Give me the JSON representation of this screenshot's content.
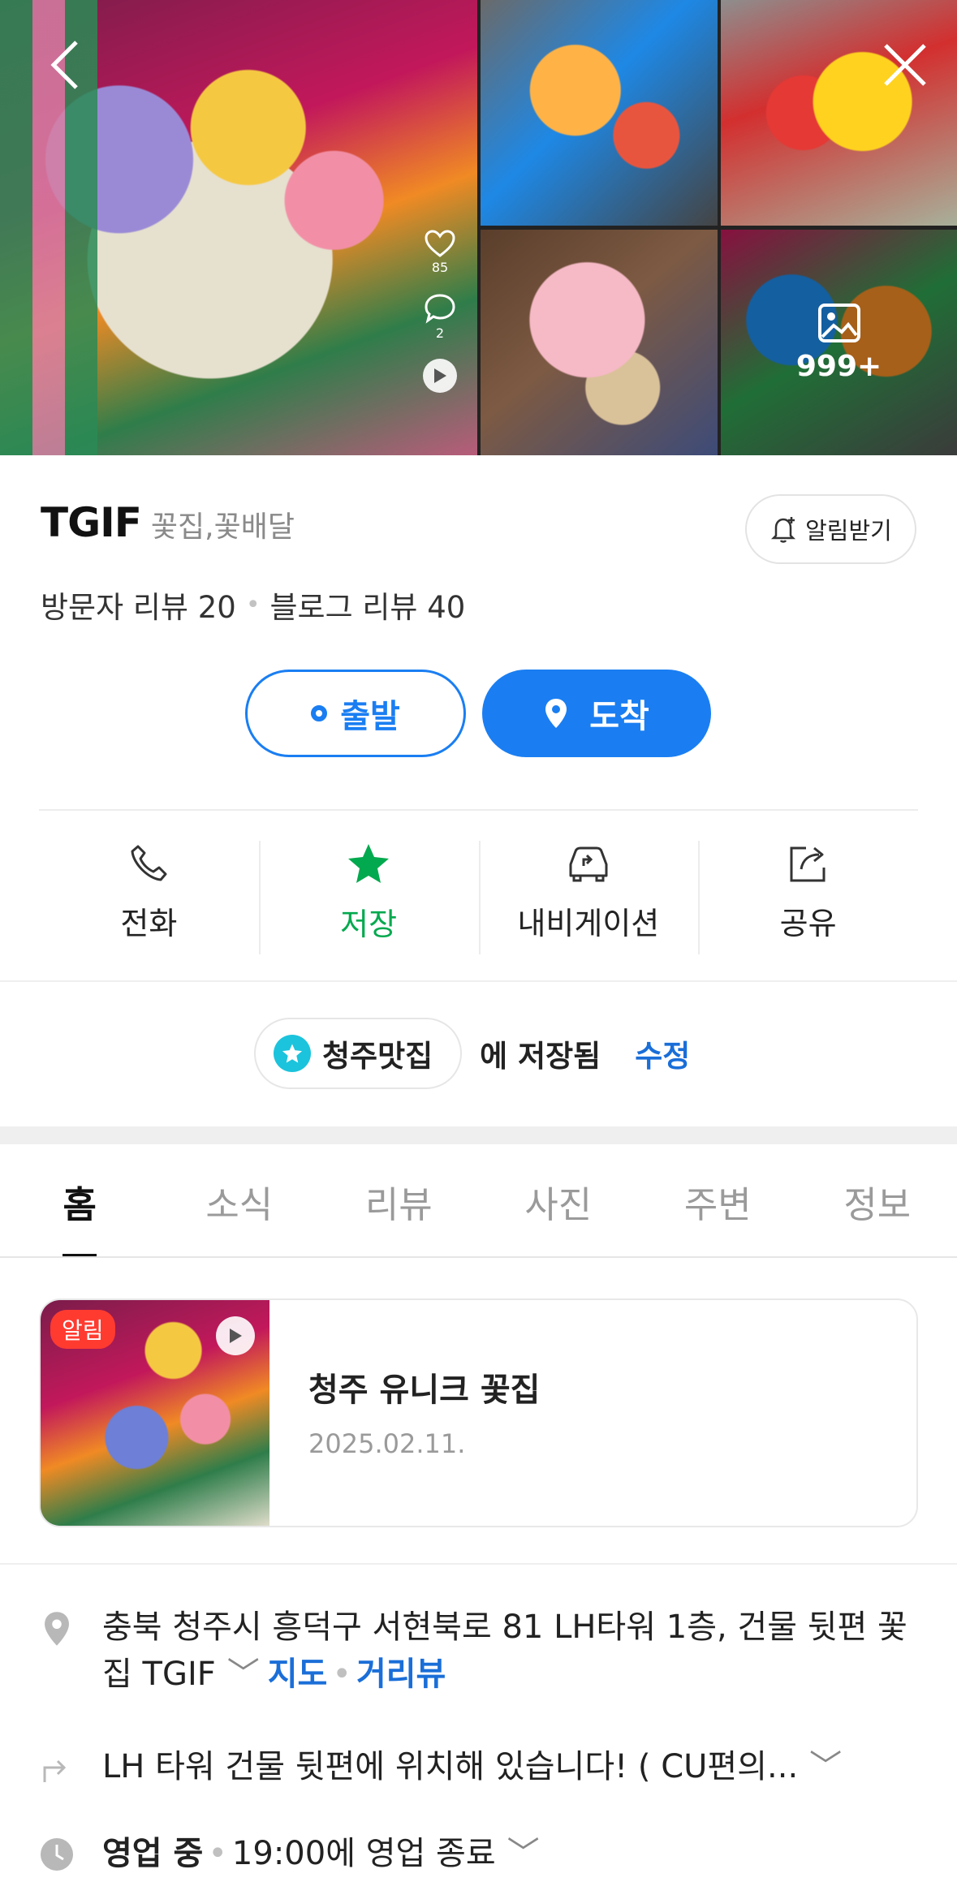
{
  "gallery": {
    "likes": "85",
    "comments": "2",
    "more_count": "999+"
  },
  "header": {
    "store_name": "TGIF",
    "category": "꽃집,꽃배달",
    "alarm_label": "알림받기"
  },
  "reviews": {
    "visitor": "방문자 리뷰 20",
    "blog": "블로그 리뷰 40"
  },
  "route": {
    "depart_label": "출발",
    "arrive_label": "도착",
    "primary_color": "#1a7ef2"
  },
  "actions": [
    {
      "label": "전화",
      "icon": "phone-icon"
    },
    {
      "label": "저장",
      "icon": "star-icon"
    },
    {
      "label": "내비게이션",
      "icon": "car-icon"
    },
    {
      "label": "공유",
      "icon": "share-icon"
    }
  ],
  "saved": {
    "list_name": "청주맛집",
    "saved_text": "에 저장됨",
    "edit_label": "수정",
    "save_color": "#03a94e"
  },
  "tabs": [
    {
      "label": "홈",
      "active": true
    },
    {
      "label": "소식"
    },
    {
      "label": "리뷰"
    },
    {
      "label": "사진"
    },
    {
      "label": "주변"
    },
    {
      "label": "정보"
    }
  ],
  "news": {
    "badge": "알림",
    "title": "청주 유니크 꽃집",
    "date": "2025.02.11."
  },
  "info": {
    "address_line1": "충북 청주시 흥덕구 서현북로 81 LH타워 1층, 건물 뒷편 꽃",
    "address_line2": "집 TGIF",
    "map_link": "지도",
    "street_link": "거리뷰",
    "directions": "LH 타워 건물 뒷편에 위치해 있습니다! ( CU편의...",
    "status": "영업 중",
    "hours": "19:00에 영업 종료"
  }
}
